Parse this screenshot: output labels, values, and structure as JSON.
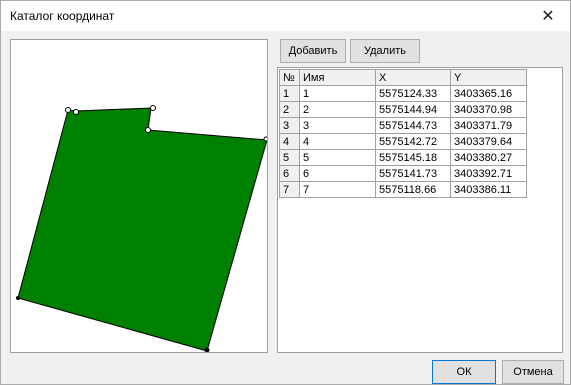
{
  "window": {
    "title": "Каталог координат",
    "close_glyph": "✕"
  },
  "toolbar": {
    "add_label": "Добавить",
    "delete_label": "Удалить"
  },
  "table": {
    "headers": [
      "№",
      "Имя",
      "X",
      "Y"
    ],
    "rows": [
      {
        "num": "1",
        "name": "1",
        "x": "5575124.33",
        "y": "3403365.16"
      },
      {
        "num": "2",
        "name": "2",
        "x": "5575144.94",
        "y": "3403370.98"
      },
      {
        "num": "3",
        "name": "3",
        "x": "5575144.73",
        "y": "3403371.79"
      },
      {
        "num": "4",
        "name": "4",
        "x": "5575142.72",
        "y": "3403379.64"
      },
      {
        "num": "5",
        "name": "5",
        "x": "5575145.18",
        "y": "3403380.27"
      },
      {
        "num": "6",
        "name": "6",
        "x": "5575141.73",
        "y": "3403392.71"
      },
      {
        "num": "7",
        "name": "7",
        "x": "5575118.66",
        "y": "3403386.11"
      }
    ]
  },
  "footer": {
    "ok_label": "ОК",
    "cancel_label": "Отмена"
  },
  "colors": {
    "parcel_fill": "#008000",
    "parcel_stroke": "#000000",
    "accent": "#0078d7"
  }
}
